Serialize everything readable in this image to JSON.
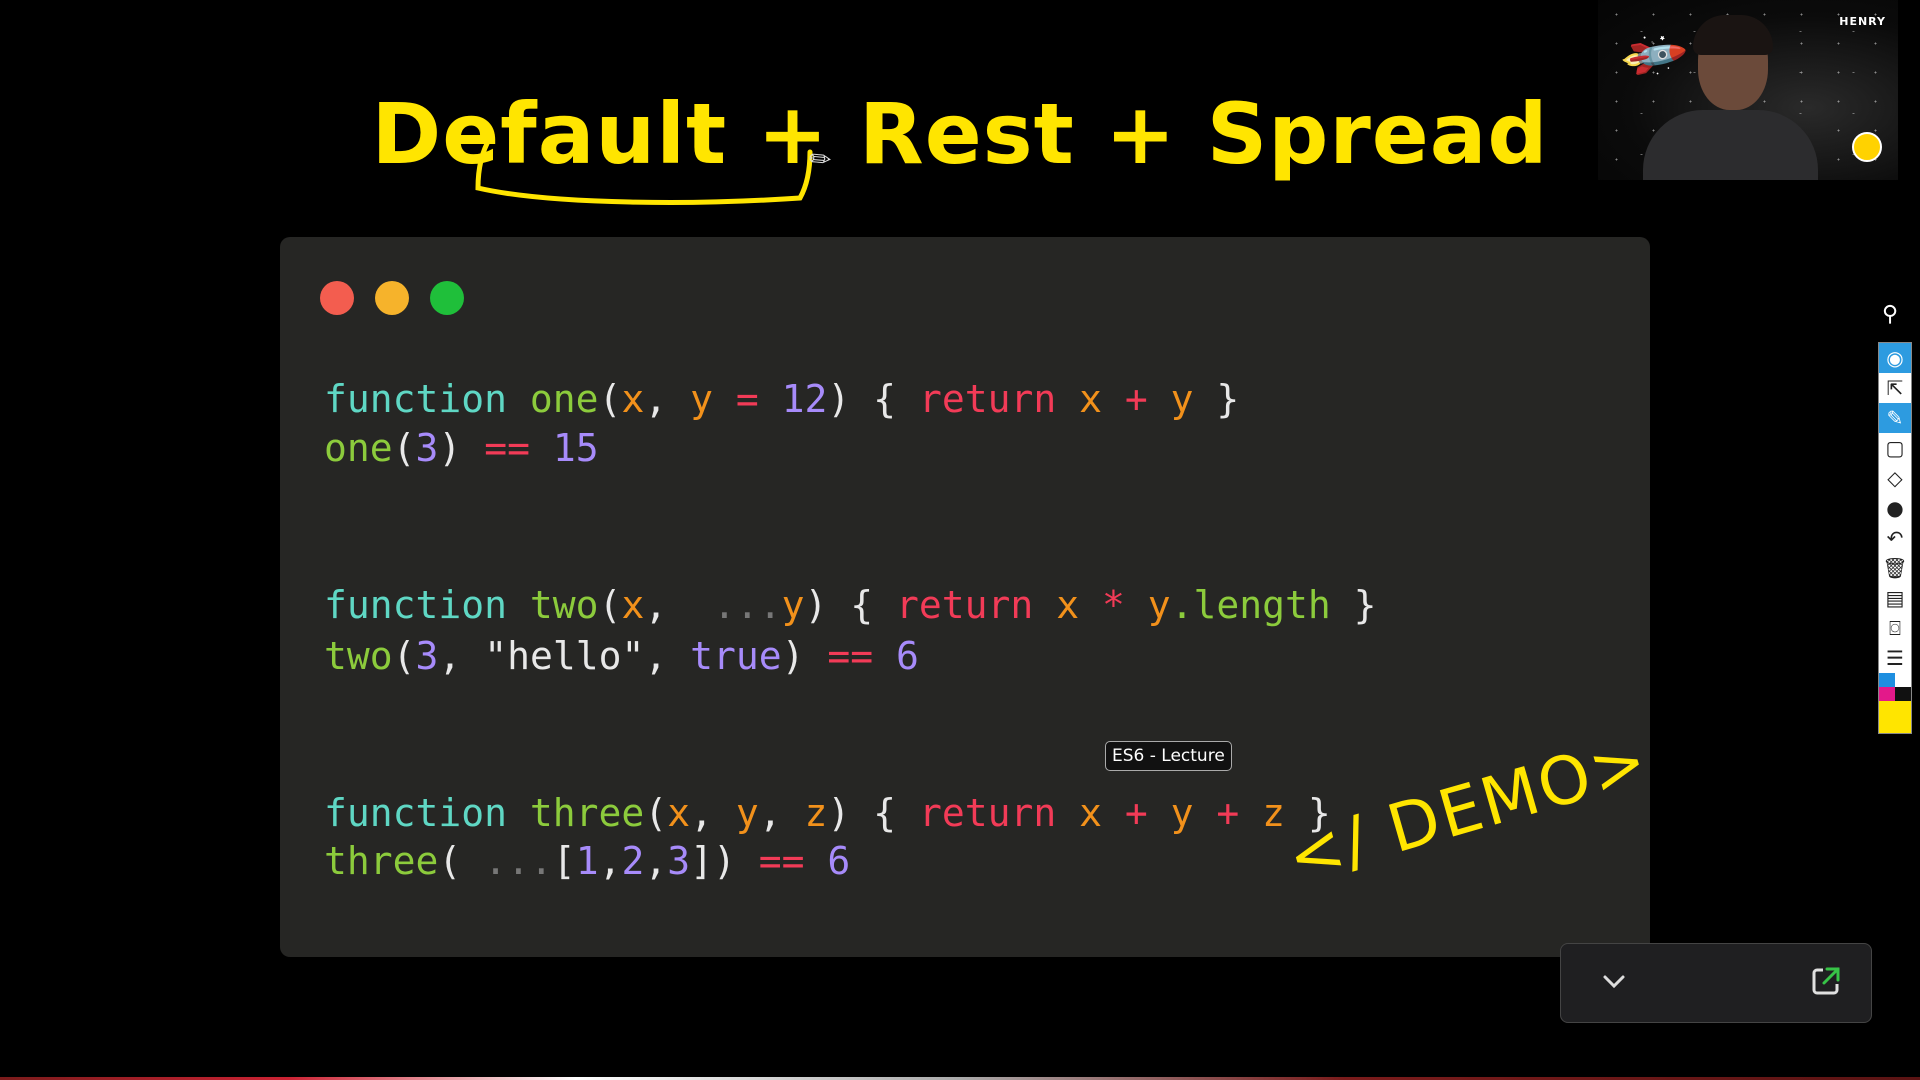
{
  "slide": {
    "title": "Default + Rest + Spread",
    "code_lines": {
      "l1": {
        "kw": "function",
        "fn": "one",
        "a": "(",
        "x": "x",
        ",": ", ",
        "y": "y",
        "eq": " = ",
        "n12": "12",
        ")": ")",
        " {": " { ",
        "ret": "return",
        "x2": " x ",
        "plus": "+",
        "y2": " y ",
        "close": "}"
      },
      "l2": {
        "fn": "one",
        "a": "(",
        "n": "3",
        "b": ")",
        "eq": " == ",
        "n2": "15"
      },
      "l3": {
        "kw": "function",
        "fn": "two",
        "a": "(",
        "x": "x",
        ",": ", ",
        "dots": " ...",
        "y": "y",
        "b": ")",
        "ob": " { ",
        "ret": "return",
        "x2": " x ",
        "mul": "*",
        "y2": " y",
        "len": ".length",
        "cb": " }"
      },
      "l4": {
        "fn": "two",
        "a": "(",
        "n": "3",
        ",": ", ",
        "s": "\"hello\"",
        ",2": ", ",
        "t": "true",
        "b": ")",
        "eq": " == ",
        "n2": "6"
      },
      "l5": {
        "kw": "function",
        "fn": "three",
        "a": "(",
        "x": "x",
        ",": ", ",
        "y": "y",
        ",2": ", ",
        "z": "z",
        "b": ")",
        "ob": " { ",
        "ret": "return",
        "x2": " x ",
        "p1": "+",
        "y2": " y ",
        "p2": "+",
        "z2": " z ",
        "cb": "}"
      },
      "l6": {
        "fn": "three",
        "a": "(",
        "dots": " ...",
        "ob": "[",
        "n1": "1",
        "c1": ",",
        "n2": "2",
        "c2": ",",
        "n3": "3",
        "cb": "])",
        "eq": " == ",
        "n4": "6"
      }
    },
    "annotation": "</ DEMO>",
    "tooltip": "ES6 - Lecture"
  },
  "webcam": {
    "name": "HENRY"
  },
  "colors": {
    "yellow": "#ffe500",
    "red_dot": "#f35d4f",
    "yellow_dot": "#f6b32b",
    "green_dot": "#1fbf3a",
    "card": "#262624"
  },
  "toolbar": {
    "icons": [
      "pen-icon",
      "eye-icon",
      "cursor-icon",
      "highlighter-icon",
      "rectangle-icon",
      "eraser-icon",
      "dot-icon",
      "undo-icon",
      "trash-icon",
      "whiteboard-icon",
      "camera-icon",
      "clipboard-icon",
      "color-palette-icon"
    ]
  },
  "panel": {
    "icons": [
      "chevron-down-icon",
      "external-link-icon"
    ]
  }
}
